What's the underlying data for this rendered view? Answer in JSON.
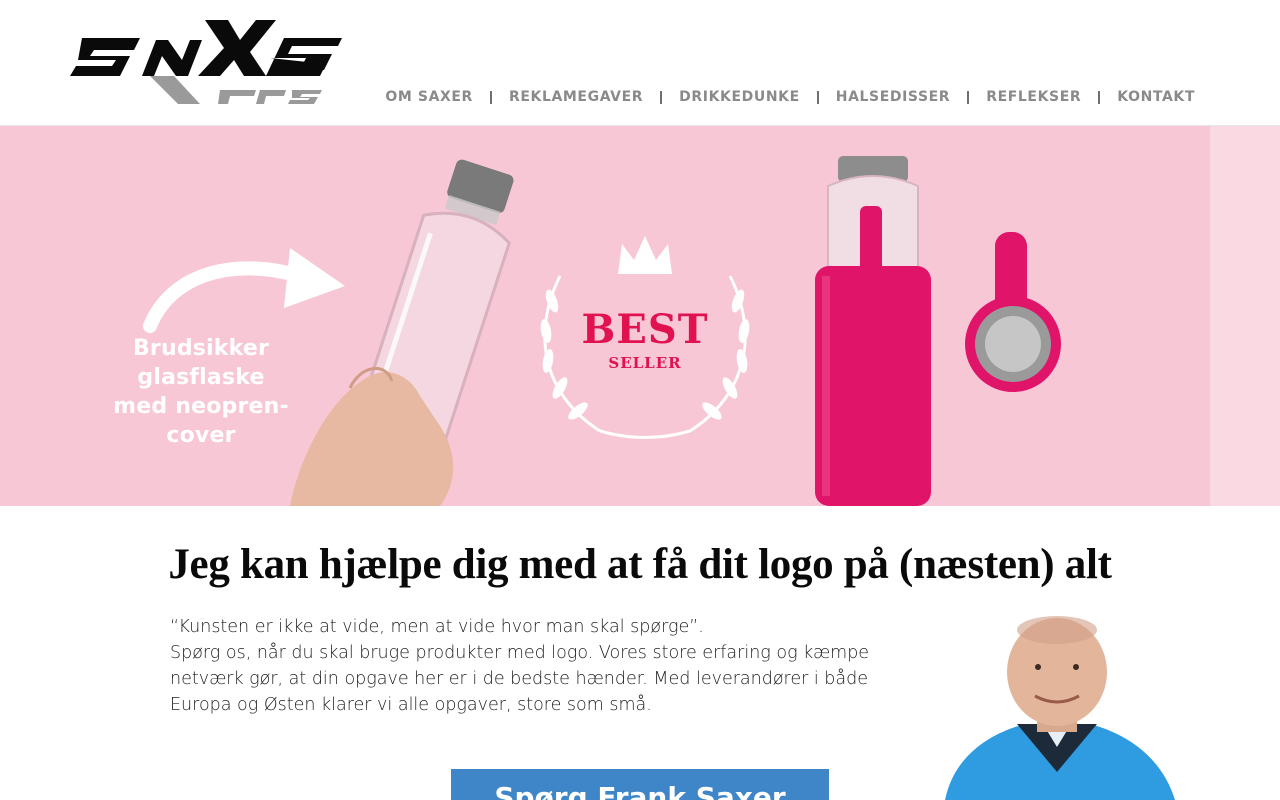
{
  "brand": {
    "logo_text": "SAXER",
    "logo_subtext": "APS"
  },
  "nav": {
    "items": [
      {
        "label": "OM SAXER"
      },
      {
        "label": "REKLAMEGAVER"
      },
      {
        "label": "DRIKKEDUNKE"
      },
      {
        "label": "HALSEDISSER"
      },
      {
        "label": "REFLEKSER"
      },
      {
        "label": "KONTAKT"
      }
    ]
  },
  "hero": {
    "text_lines": [
      "Brudsikker",
      "glasflaske",
      "med neopren-",
      "cover"
    ],
    "badge_title": "BEST",
    "badge_subtitle": "SELLER",
    "background_color": "#f8c7d6",
    "accent_color": "#e0124f"
  },
  "main": {
    "headline": "Jeg kan hjælpe dig med at få dit logo på (næsten) alt",
    "quote": "“Kunsten er ikke at vide, men at vide hvor man skal spørge”.",
    "body": "Spørg os, når du skal bruge produkter med logo. Vores store erfaring og kæmpe netværk gør, at din opgave her er i de bedste hænder. Med leverandører i både Europa og Østen klarer vi alle opgaver, store som små.",
    "cta_label": "Spørg Frank Saxer",
    "cta_color": "#3f86c8"
  }
}
